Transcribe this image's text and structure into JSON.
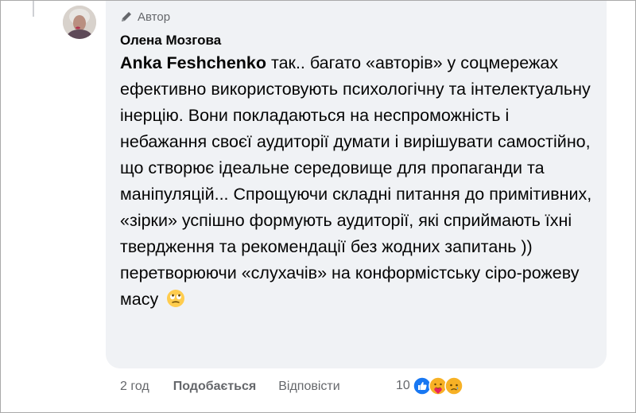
{
  "comment": {
    "author_badge_label": "Автор",
    "author_name": "Олена Мозгова",
    "mention": "Anka Feshchenko",
    "text": " так.. багато «авторів» у соцмережах ефективно використовують психологічну та інтелектуальну інерцію. Вони покладаються на неспроможність і небажання своєї аудиторії думати і вирішувати самостійно, що створює ідеальне середовище для пропаганди та маніпуляцій... Спрощуючи складні питання до примітивних, «зірки» успішно формують аудиторії, які сприймають їхні твердження та рекомендації без жодних запитань )) перетворюючи «слухачів» на конформістську сіро-рожеву масу",
    "trailing_emoji": "rolling-eyes-emoji"
  },
  "actions": {
    "time": "2 год",
    "like_label": "Подобається",
    "reply_label": "Відповісти"
  },
  "reactions": {
    "count": "10",
    "icons": [
      "like-reaction-icon",
      "care-reaction-icon",
      "sad-reaction-icon"
    ]
  },
  "colors": {
    "bubble": "#f0f2f5",
    "text": "#050505",
    "secondary": "#65676b",
    "like_blue": "#1877f2"
  }
}
